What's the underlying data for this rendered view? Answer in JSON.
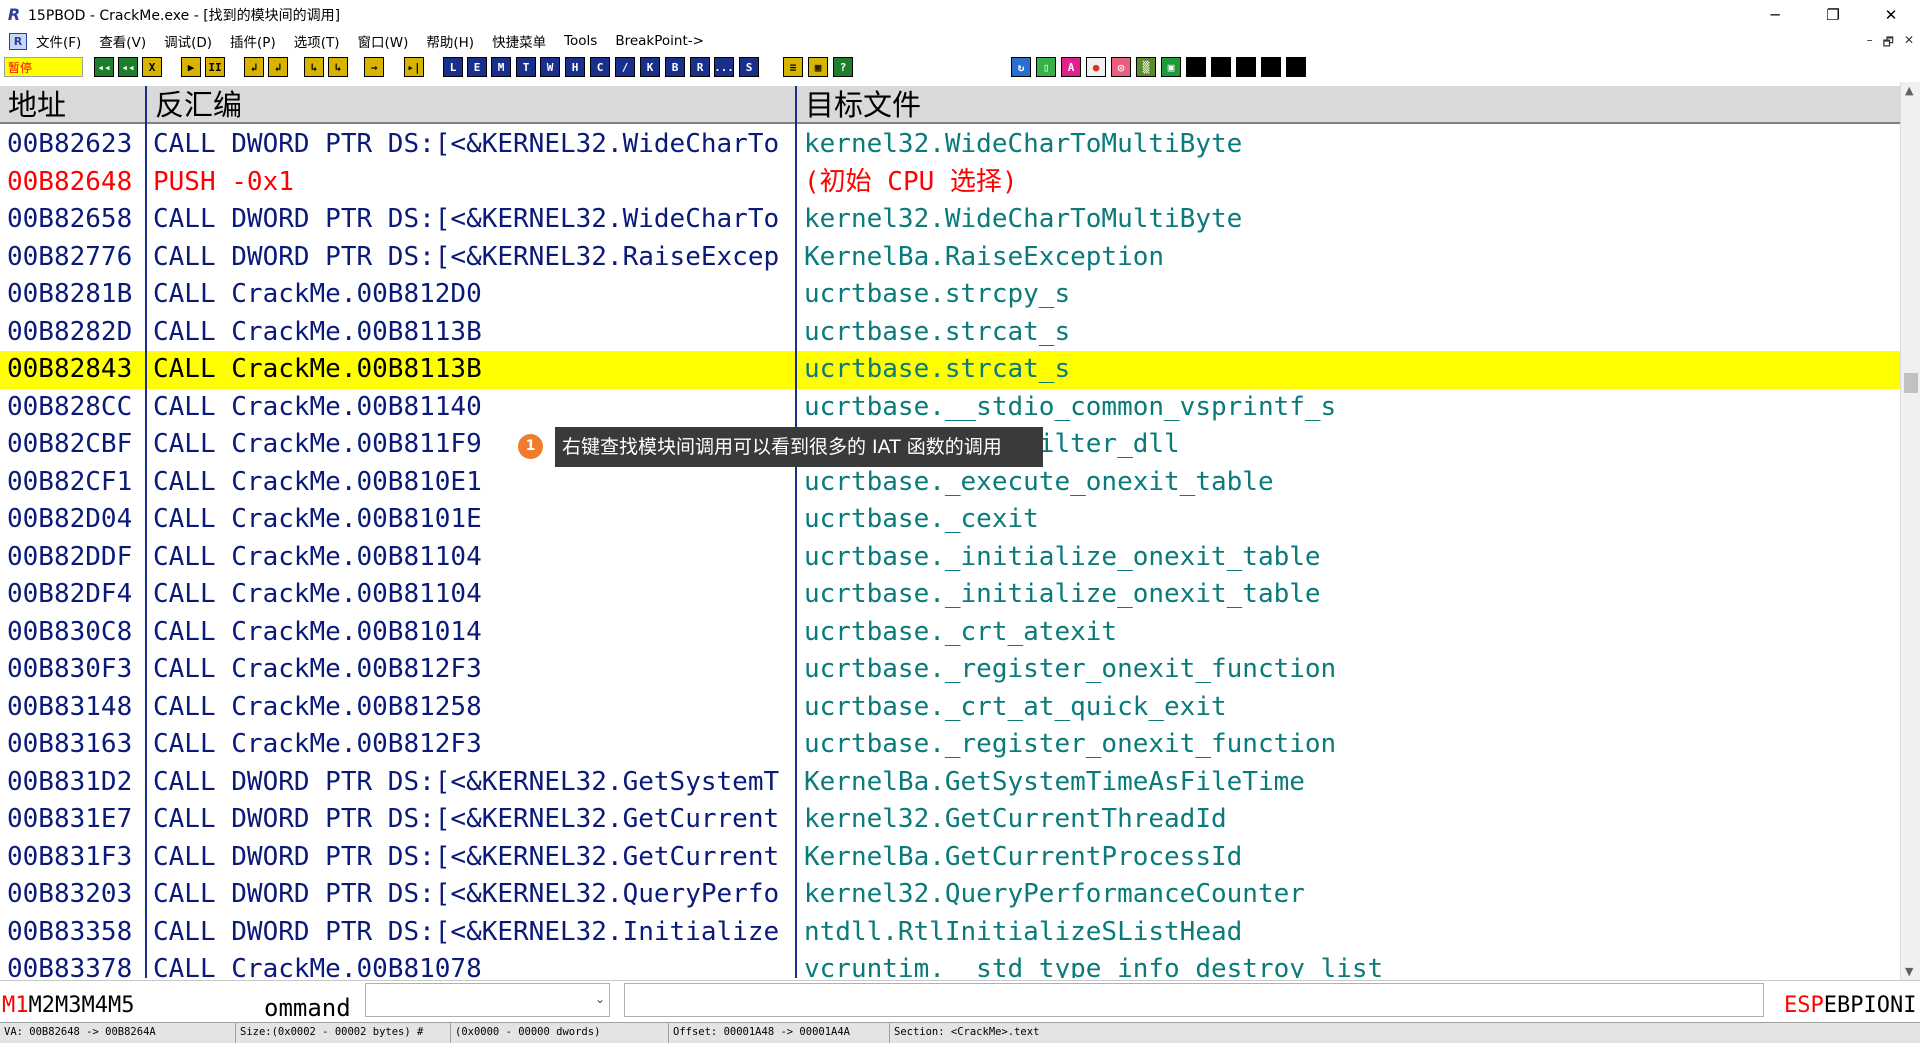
{
  "window": {
    "title": "15PBOD - CrackMe.exe - [找到的模块间的调用]",
    "app_icon": "R",
    "minimize": "─",
    "restore": "❐",
    "close": "✕"
  },
  "menu": {
    "logo": "R",
    "items": [
      "文件(F)",
      "查看(V)",
      "调试(D)",
      "插件(P)",
      "选项(T)",
      "窗口(W)",
      "帮助(H)",
      "快捷菜单",
      "Tools",
      "BreakPoint->"
    ],
    "mdi_min": "–",
    "mdi_restore": "🗗",
    "mdi_close": "✕"
  },
  "toolbar": {
    "status": "暂停",
    "buttons_a": [
      "◂◂",
      "◂◂",
      "X",
      "▶",
      "II",
      "↲",
      "↲",
      "↳",
      "↳",
      "→",
      "▸|"
    ],
    "buttons_b": [
      "L",
      "E",
      "M",
      "T",
      "W",
      "H",
      "C",
      "/",
      "K",
      "B",
      "R",
      "...",
      "S"
    ],
    "buttons_c": [
      "≡",
      "▦",
      "?"
    ],
    "buttons_d": [
      "↻",
      "▯",
      "A",
      "●",
      "◎",
      "▒",
      "▣",
      "",
      "",
      "",
      "",
      ""
    ]
  },
  "columns": {
    "address": "地址",
    "disasm": "反汇编",
    "target": "目标文件"
  },
  "rows": [
    {
      "addr": "00B82623",
      "disasm": "CALL DWORD PTR DS:[<&KERNEL32.WideCharTo",
      "target": "kernel32.WideCharToMultiByte",
      "red": false,
      "hl": false
    },
    {
      "addr": "00B82648",
      "disasm": "PUSH -0x1",
      "target": "(初始 CPU 选择)",
      "red": true,
      "hl": false
    },
    {
      "addr": "00B82658",
      "disasm": "CALL DWORD PTR DS:[<&KERNEL32.WideCharTo",
      "target": "kernel32.WideCharToMultiByte",
      "red": false,
      "hl": false
    },
    {
      "addr": "00B82776",
      "disasm": "CALL DWORD PTR DS:[<&KERNEL32.RaiseExcep",
      "target": "KernelBa.RaiseException",
      "red": false,
      "hl": false
    },
    {
      "addr": "00B8281B",
      "disasm": "CALL CrackMe.00B812D0",
      "target": "ucrtbase.strcpy_s",
      "red": false,
      "hl": false
    },
    {
      "addr": "00B8282D",
      "disasm": "CALL CrackMe.00B8113B",
      "target": "ucrtbase.strcat_s",
      "red": false,
      "hl": false
    },
    {
      "addr": "00B82843",
      "disasm": "CALL CrackMe.00B8113B",
      "target": "ucrtbase.strcat_s",
      "red": false,
      "hl": true
    },
    {
      "addr": "00B828CC",
      "disasm": "CALL CrackMe.00B81140",
      "target": "ucrtbase.__stdio_common_vsprintf_s",
      "red": false,
      "hl": false
    },
    {
      "addr": "00B82CBF",
      "disasm": "CALL CrackMe.00B811F9",
      "target": "ucrtbase._seh_filter_dll",
      "red": false,
      "hl": false
    },
    {
      "addr": "00B82CF1",
      "disasm": "CALL CrackMe.00B810E1",
      "target": "ucrtbase._execute_onexit_table",
      "red": false,
      "hl": false
    },
    {
      "addr": "00B82D04",
      "disasm": "CALL CrackMe.00B8101E",
      "target": "ucrtbase._cexit",
      "red": false,
      "hl": false
    },
    {
      "addr": "00B82DDF",
      "disasm": "CALL CrackMe.00B81104",
      "target": "ucrtbase._initialize_onexit_table",
      "red": false,
      "hl": false
    },
    {
      "addr": "00B82DF4",
      "disasm": "CALL CrackMe.00B81104",
      "target": "ucrtbase._initialize_onexit_table",
      "red": false,
      "hl": false
    },
    {
      "addr": "00B830C8",
      "disasm": "CALL CrackMe.00B81014",
      "target": "ucrtbase._crt_atexit",
      "red": false,
      "hl": false
    },
    {
      "addr": "00B830F3",
      "disasm": "CALL CrackMe.00B812F3",
      "target": "ucrtbase._register_onexit_function",
      "red": false,
      "hl": false
    },
    {
      "addr": "00B83148",
      "disasm": "CALL CrackMe.00B81258",
      "target": "ucrtbase._crt_at_quick_exit",
      "red": false,
      "hl": false
    },
    {
      "addr": "00B83163",
      "disasm": "CALL CrackMe.00B812F3",
      "target": "ucrtbase._register_onexit_function",
      "red": false,
      "hl": false
    },
    {
      "addr": "00B831D2",
      "disasm": "CALL DWORD PTR DS:[<&KERNEL32.GetSystemT",
      "target": "KernelBa.GetSystemTimeAsFileTime",
      "red": false,
      "hl": false
    },
    {
      "addr": "00B831E7",
      "disasm": "CALL DWORD PTR DS:[<&KERNEL32.GetCurrent",
      "target": "kernel32.GetCurrentThreadId",
      "red": false,
      "hl": false
    },
    {
      "addr": "00B831F3",
      "disasm": "CALL DWORD PTR DS:[<&KERNEL32.GetCurrent",
      "target": "KernelBa.GetCurrentProcessId",
      "red": false,
      "hl": false
    },
    {
      "addr": "00B83203",
      "disasm": "CALL DWORD PTR DS:[<&KERNEL32.QueryPerfo",
      "target": "kernel32.QueryPerformanceCounter",
      "red": false,
      "hl": false
    },
    {
      "addr": "00B83358",
      "disasm": "CALL DWORD PTR DS:[<&KERNEL32.Initialize",
      "target": "ntdll.RtlInitializeSListHead",
      "red": false,
      "hl": false
    },
    {
      "addr": "00B83378",
      "disasm": "CALL CrackMe.00B81078",
      "target": "vcruntim.__std_type_info_destroy_list",
      "red": false,
      "hl": false
    }
  ],
  "tooltip": {
    "badge": "1",
    "text": "右键查找模块间调用可以看到很多的 IAT 函数的调用"
  },
  "command": {
    "mtabs_active": "M1",
    "mtabs_rest": "M2M3M4M5",
    "label": "ommand",
    "combo_value": "",
    "input_value": "",
    "regs": [
      {
        "text": "ESP",
        "red": true
      },
      {
        "text": "EBP",
        "red": false
      },
      {
        "text": "IONI",
        "red": false
      }
    ]
  },
  "statusbar": {
    "va": "VA: 00B82648 -> 00B8264A",
    "size": "Size:(0x0002 - 00002 bytes)  #",
    "dwords": "(0x0000 - 00000 dwords)",
    "offset": "Offset: 00001A48 -> 00001A4A",
    "section": "Section: <CrackMe>.text"
  },
  "colors": {
    "address_text": "#0a1a7a",
    "target_text": "#0a7a7a",
    "highlight_row": "#ffff00",
    "red_text": "#ff0000",
    "tooltip_bg": "#3a3a3a",
    "tooltip_badge": "#f07b2a"
  }
}
